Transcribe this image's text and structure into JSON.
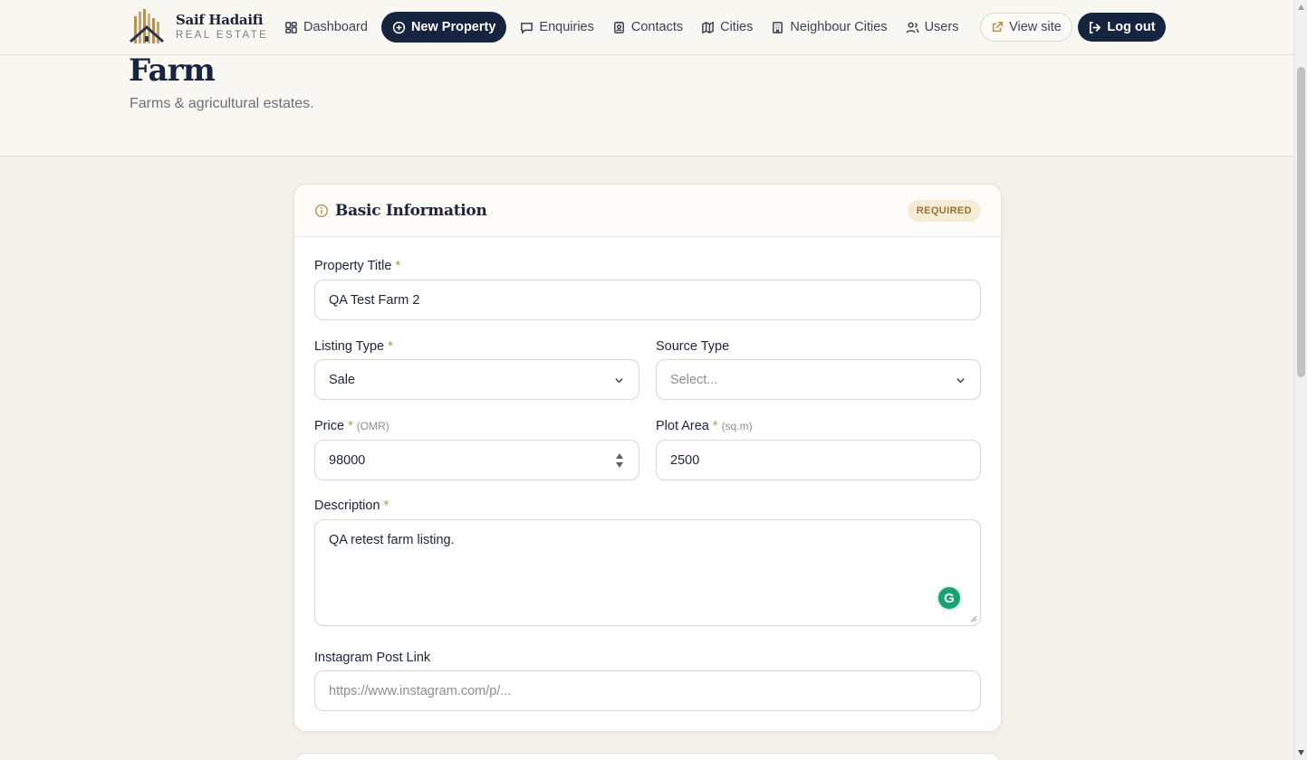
{
  "brand": {
    "name": "Saif Hadaifi",
    "tagline": "REAL ESTATE"
  },
  "nav": {
    "items": [
      {
        "label": "Dashboard",
        "icon": "dashboard-grid-icon"
      },
      {
        "label": "New Property",
        "icon": "plus-circle-icon",
        "active": true
      },
      {
        "label": "Enquiries",
        "icon": "message-icon"
      },
      {
        "label": "Contacts",
        "icon": "contact-card-icon"
      },
      {
        "label": "Cities",
        "icon": "map-icon"
      },
      {
        "label": "Neighbour Cities",
        "icon": "building-icon"
      },
      {
        "label": "Users",
        "icon": "users-icon"
      }
    ],
    "view_site": "View site",
    "logout": "Log out"
  },
  "page": {
    "title": "Farm",
    "subtitle": "Farms & agricultural estates."
  },
  "card": {
    "title": "Basic Information",
    "badge": "REQUIRED",
    "fields": {
      "title": {
        "label": "Property Title",
        "required": "*",
        "value": "QA Test Farm 2"
      },
      "listing_type": {
        "label": "Listing Type",
        "required": "*",
        "value": "Sale"
      },
      "source_type": {
        "label": "Source Type",
        "placeholder": "Select..."
      },
      "price": {
        "label": "Price",
        "required": "*",
        "unit": "(OMR)",
        "value": "98000"
      },
      "plot_area": {
        "label": "Plot Area",
        "required": "*",
        "unit": "(sq.m)",
        "value": "2500"
      },
      "description": {
        "label": "Description",
        "required": "*",
        "value": "QA retest farm listing."
      },
      "instagram": {
        "label": "Instagram Post Link",
        "placeholder": "https://www.instagram.com/p/..."
      }
    }
  },
  "colors": {
    "navy": "#172440",
    "gold": "#b89150",
    "background": "#f3f1ea",
    "grammarly": "#15a374"
  }
}
